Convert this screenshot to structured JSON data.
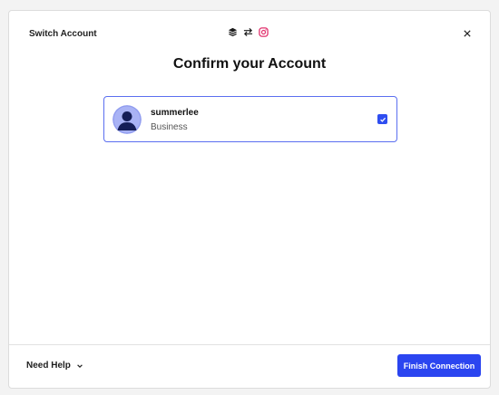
{
  "modal": {
    "title": "Switch Account",
    "heading": "Confirm your Account"
  },
  "header_icons": [
    "buffer-layers-icon",
    "swap-arrows-icon",
    "instagram-icon"
  ],
  "account": {
    "username": "summerlee",
    "type": "Business",
    "selected": true
  },
  "footer": {
    "help_label": "Need Help",
    "finish_label": "Finish Connection"
  },
  "colors": {
    "accent": "#2b45f0",
    "card_border": "#5b6ff0",
    "instagram": "#e1306c",
    "avatar_bg": "#a9b3f5",
    "avatar_figure": "#151e57"
  }
}
